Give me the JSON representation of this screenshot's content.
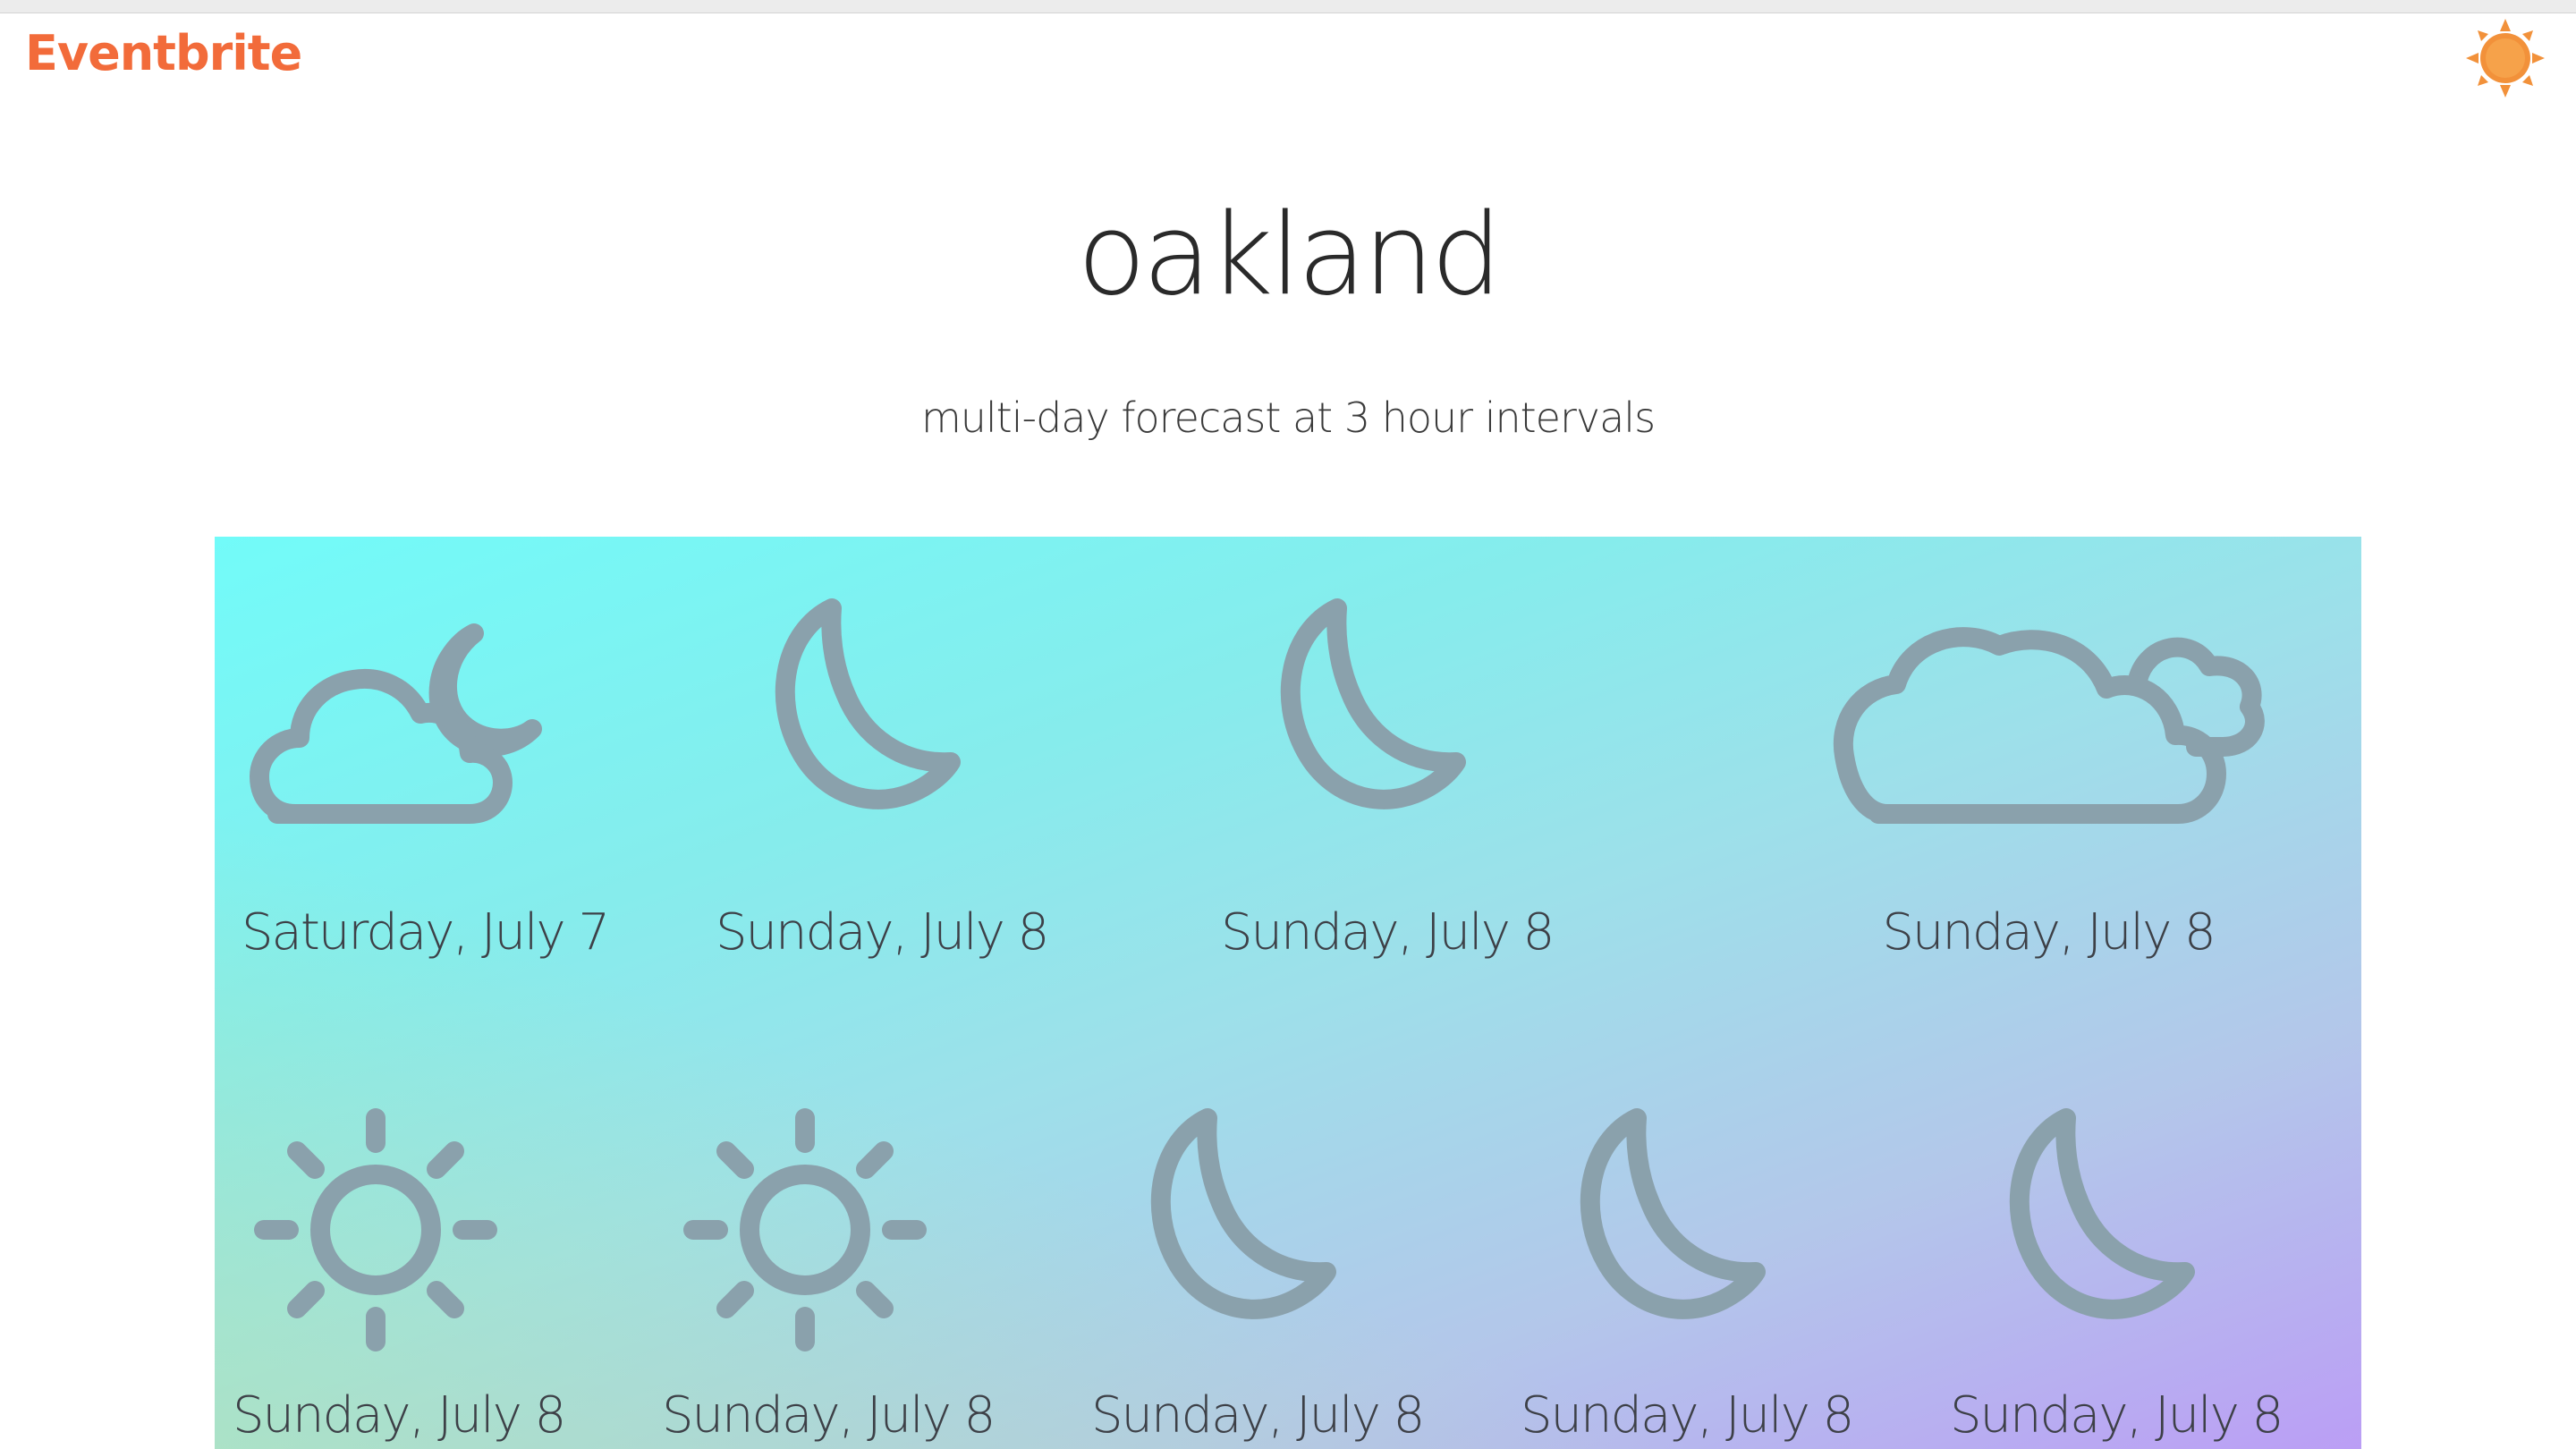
{
  "brand": {
    "name": "Eventbrite",
    "color": "#f26b3a"
  },
  "header": {
    "badge_icon": "sun-badge-icon"
  },
  "page": {
    "city": "oakland",
    "subtitle": "multi-day forecast at 3 hour intervals"
  },
  "colors": {
    "icon": "#8aa1ac",
    "gradient_top": "#72fbf9",
    "gradient_bottom": "#bb9ef5"
  },
  "forecast": [
    {
      "label": "Saturday, July 7",
      "icon": "partly-cloudy-night-icon"
    },
    {
      "label": "Sunday, July 8",
      "icon": "moon-icon"
    },
    {
      "label": "Sunday, July 8",
      "icon": "moon-icon"
    },
    {
      "label": "Sunday, July 8",
      "icon": "cloudy-icon"
    },
    {
      "label": "Sunday, July 8",
      "icon": "sun-icon"
    },
    {
      "label": "Sunday, July 8",
      "icon": "sun-icon"
    },
    {
      "label": "Sunday, July 8",
      "icon": "moon-icon"
    },
    {
      "label": "Sunday, July 8",
      "icon": "moon-icon"
    },
    {
      "label": "Sunday, July 8",
      "icon": "moon-icon"
    }
  ]
}
